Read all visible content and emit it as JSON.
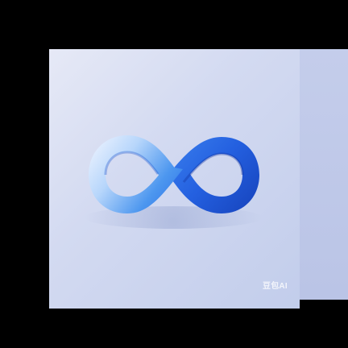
{
  "image": {
    "icon": "infinity-symbol-icon",
    "watermark_text": "豆包AI"
  },
  "colors": {
    "background": "#000000",
    "card_light": "#e6e9f6",
    "card_dark": "#c2cdeb",
    "infinity_light": "#f0f6ff",
    "infinity_mid": "#5aa0f0",
    "infinity_dark": "#1a4fd0"
  }
}
